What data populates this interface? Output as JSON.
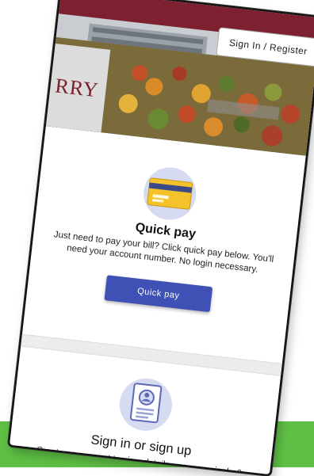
{
  "header": {
    "signin_label": "Sign In / Register",
    "logo_text": "RRY"
  },
  "quick_pay": {
    "title": "Quick pay",
    "description": "Just need to pay your bill? Click quick pay below. You'll need your account number. No login necessary.",
    "button_label": "Quick pay",
    "icon": "credit-card-icon"
  },
  "sign_in": {
    "title": "Sign in or sign up",
    "description": "Create an account to view details, manage single & multi-accounts, multi-bill pay, and e-Billing.",
    "icon": "account-document-icon"
  },
  "colors": {
    "primary_button": "#3f51b5",
    "brand_red": "#7a2130",
    "icon_bg": "#d7dbf2",
    "card_gold": "#f4c32b",
    "band_green": "#5fbf45"
  }
}
